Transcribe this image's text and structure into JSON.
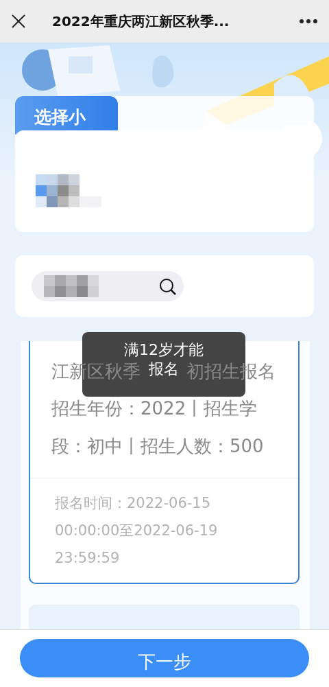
{
  "header": {
    "title": "2022年重庆两江新区秋季..."
  },
  "child_section": {
    "tab_label": "选择小"
  },
  "school_card": {
    "name_parts": [
      "江新区秋季",
      "初招生报名"
    ],
    "info": "招生年份：2022丨招生学段：初中丨招生人数：500",
    "time": "报名时间：2022-06-15 00:00:00至2022-06-19 23:59:59"
  },
  "toast": {
    "lines": [
      "满12岁才能",
      "报名"
    ]
  },
  "next_button": "下一步"
}
